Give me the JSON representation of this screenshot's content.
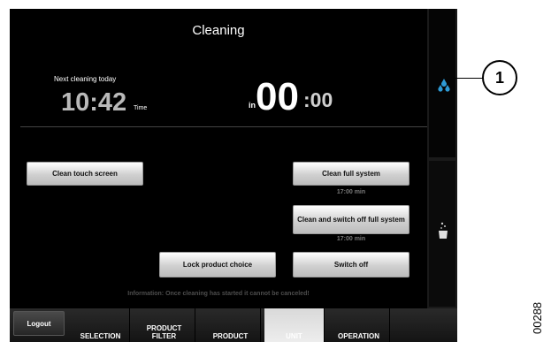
{
  "screen": {
    "title": "Cleaning",
    "next_cleaning_label": "Next cleaning today",
    "next_cleaning_time": "10:42",
    "time_suffix": "Time",
    "in_label": "in",
    "countdown_minutes": "00",
    "countdown_seconds": ":00",
    "buttons": {
      "clean_touch_screen": "Clean touch screen",
      "clean_full_system": "Clean full system",
      "clean_full_system_duration": "17:00 min",
      "clean_and_switch_off": "Clean and switch off full system",
      "clean_and_switch_off_duration": "17:00 min",
      "lock_product_choice": "Lock product choice",
      "switch_off": "Switch off"
    },
    "information": "Information: Once cleaning has started it cannot be canceled!"
  },
  "side_panel": {
    "top_icon": "water-drops-icon",
    "bottom_icon": "cup-icon",
    "drops_color": "#2e9bd6"
  },
  "nav": {
    "logout": "Logout",
    "selection": "SELECTION",
    "product_filter": "PRODUCT FILTER",
    "product": "PRODUCT",
    "unit": "UNIT",
    "operation": "OPERATION"
  },
  "callout": {
    "number": "1"
  },
  "figure_id": "00288"
}
